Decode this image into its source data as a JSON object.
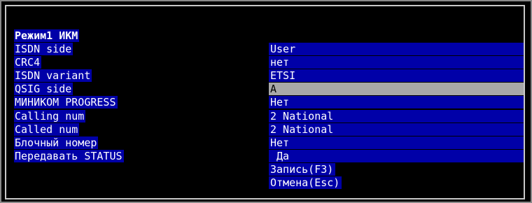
{
  "title": "Режим1 ИКМ",
  "settings": [
    {
      "label": "ISDN side",
      "value": "User"
    },
    {
      "label": "CRC4",
      "value": "нет"
    },
    {
      "label": "ISDN variant",
      "value": "ETSI"
    },
    {
      "label": "QSIG side",
      "value": "A",
      "selected": true
    },
    {
      "label": "МИНИКОМ PROGRESS",
      "value": "Нет"
    },
    {
      "label": "Calling num",
      "value": "2 National"
    },
    {
      "label": "Called num",
      "value": "2 National"
    },
    {
      "label": "Блочный номер",
      "value": "Нет"
    },
    {
      "label": "Передавать STATUS",
      "value": " Да"
    }
  ],
  "actions": {
    "save": "Запись(F3)",
    "cancel": "Отмена(Esc)"
  },
  "colors": {
    "field_bg": "#0000a8",
    "selected_bg": "#a8a8a8",
    "screen_bg": "#000000",
    "text": "#ffffff"
  }
}
